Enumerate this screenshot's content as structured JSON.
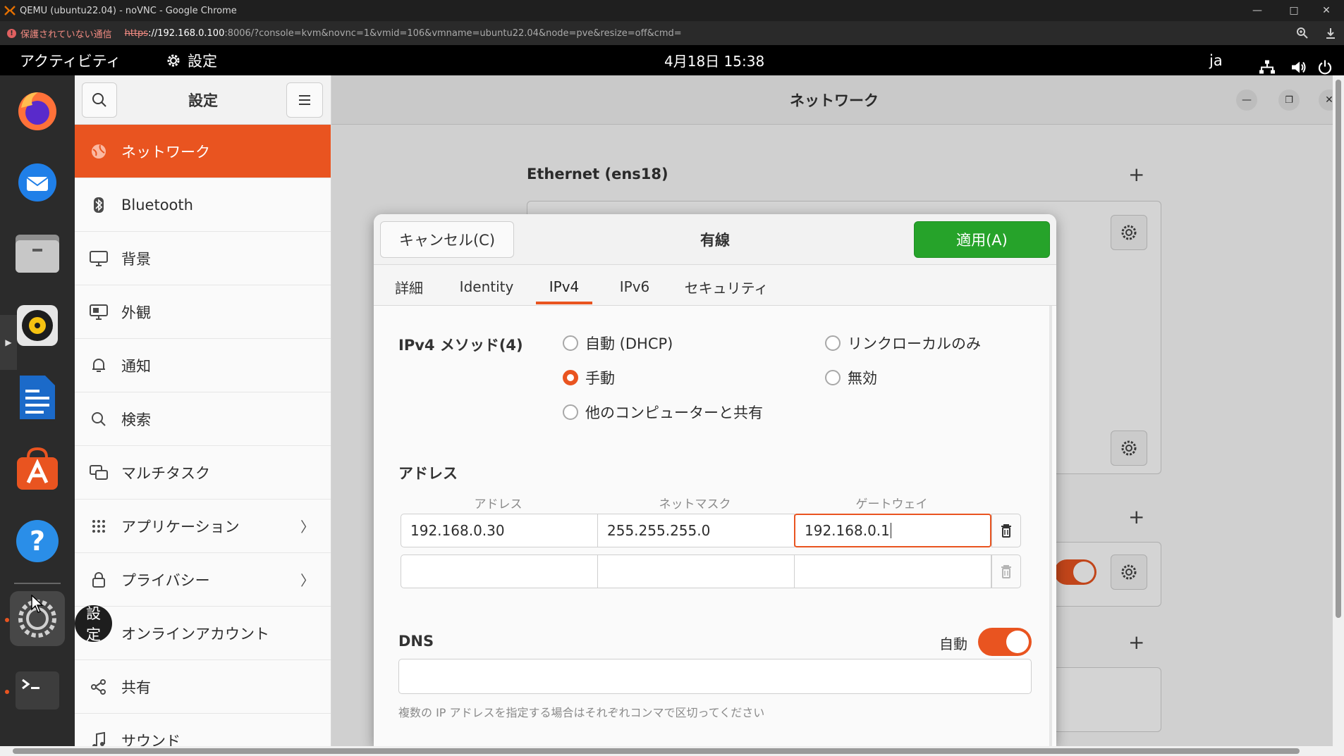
{
  "browser": {
    "window_title": "QEMU (ubuntu22.04) - noVNC - Google Chrome",
    "insecure_label": "保護されていない通信",
    "url_scheme": "https",
    "url_host": "://192.168.0.100",
    "url_rest": ":8006/?console=kvm&novnc=1&vmid=106&vmname=ubuntu22.04&node=pve&resize=off&cmd="
  },
  "topbar": {
    "activities": "アクティビティ",
    "app_name": "設定",
    "datetime": "4月18日  15:38",
    "lang": "ja"
  },
  "dock": {
    "tooltip": "設定"
  },
  "sidebar": {
    "title": "設定",
    "items": [
      {
        "label": "ネットワーク"
      },
      {
        "label": "Bluetooth"
      },
      {
        "label": "背景"
      },
      {
        "label": "外観"
      },
      {
        "label": "通知"
      },
      {
        "label": "検索"
      },
      {
        "label": "マルチタスク"
      },
      {
        "label": "アプリケーション"
      },
      {
        "label": "プライバシー"
      },
      {
        "label": "オンラインアカウント"
      },
      {
        "label": "共有"
      },
      {
        "label": "サウンド"
      }
    ]
  },
  "main": {
    "title": "ネットワーク",
    "ethernet_header": "Ethernet (ens18)"
  },
  "dialog": {
    "cancel_label": "キャンセル(C)",
    "title": "有線",
    "apply_label": "適用(A)",
    "tabs": [
      "詳細",
      "Identity",
      "IPv4",
      "IPv6",
      "セキュリティ"
    ],
    "active_tab": "IPv4",
    "method_label": "IPv4 メソッド(4)",
    "methods": {
      "auto": "自動 (DHCP)",
      "link_local": "リンクローカルのみ",
      "manual": "手動",
      "disabled": "無効",
      "shared": "他のコンピューターと共有"
    },
    "selected_method": "manual",
    "address_section": "アドレス",
    "col_address": "アドレス",
    "col_netmask": "ネットマスク",
    "col_gateway": "ゲートウェイ",
    "rows": [
      {
        "address": "192.168.0.30",
        "netmask": "255.255.255.0",
        "gateway": "192.168.0.1"
      },
      {
        "address": "",
        "netmask": "",
        "gateway": ""
      }
    ],
    "dns_section": "DNS",
    "dns_auto_label": "自動",
    "dns_auto_enabled": true,
    "dns_value": "",
    "dns_hint": "複数の IP アドレスを指定する場合はそれぞれコンマで区切ってください"
  },
  "colors": {
    "accent": "#e95420",
    "apply_green": "#26a32a"
  }
}
